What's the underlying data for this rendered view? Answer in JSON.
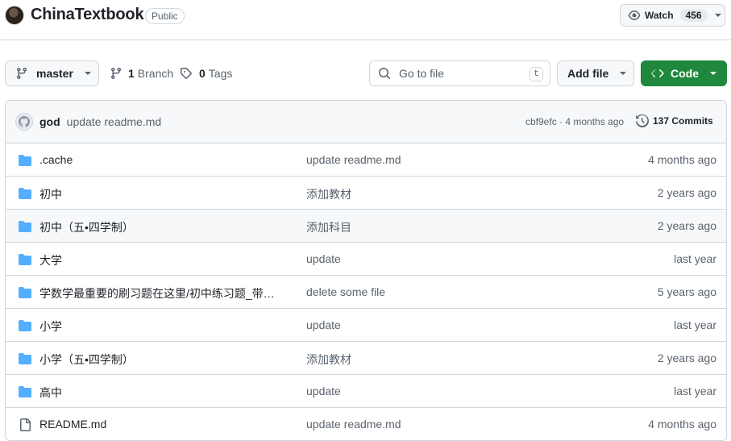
{
  "repo": {
    "name": "ChinaTextbook",
    "visibility": "Public",
    "watch_label": "Watch",
    "watch_count": "456"
  },
  "toolbar": {
    "branch": "master",
    "branches_count": "1",
    "branches_label": "Branch",
    "tags_count": "0",
    "tags_label": "Tags",
    "search_placeholder": "Go to file",
    "search_shortcut": "t",
    "add_file_label": "Add file",
    "code_label": "Code"
  },
  "latest_commit": {
    "author": "god",
    "message": "update readme.md",
    "hash_time": "cbf9efc · 4 months ago",
    "commits_label": "137 Commits"
  },
  "files": [
    {
      "type": "folder",
      "name": ".cache",
      "message": "update readme.md",
      "age": "4 months ago"
    },
    {
      "type": "folder",
      "name": "初中",
      "message": "添加教材",
      "age": "2 years ago"
    },
    {
      "type": "folder",
      "name": "初中（五•四学制）",
      "message": "添加科目",
      "age": "2 years ago"
    },
    {
      "type": "folder",
      "name": "大学",
      "message": "update",
      "age": "last year"
    },
    {
      "type": "folder",
      "name": "学数学最重要的刷习题在这里/初中练习题_带…",
      "message": "delete some file",
      "age": "5 years ago"
    },
    {
      "type": "folder",
      "name": "小学",
      "message": "update",
      "age": "last year"
    },
    {
      "type": "folder",
      "name": "小学（五•四学制）",
      "message": "添加教材",
      "age": "2 years ago"
    },
    {
      "type": "folder",
      "name": "高中",
      "message": "update",
      "age": "last year"
    },
    {
      "type": "file",
      "name": "README.md",
      "message": "update readme.md",
      "age": "4 months ago"
    }
  ],
  "colors": {
    "folder": "#54aeff",
    "code_button": "#1f883d",
    "muted_text": "#59636e",
    "border": "#d0d7de"
  }
}
